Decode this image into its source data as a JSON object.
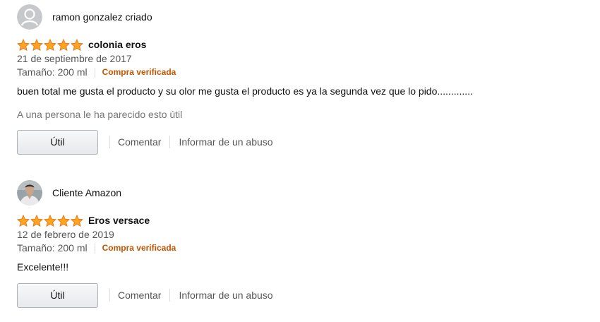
{
  "reviews": [
    {
      "author": "ramon gonzalez criado",
      "avatar": "default-avatar-icon",
      "rating": 5,
      "rating_max": 5,
      "title": "colonia eros",
      "date": "21 de septiembre de 2017",
      "size": "Tamaño: 200 ml",
      "verified": "Compra verificada",
      "body": "buen total me gusta el producto y su olor me gusta el producto es ya la segunda vez que lo pido.............",
      "helpful": "A una persona le ha parecido esto útil",
      "actions": {
        "helpful_button": "Útil",
        "comment": "Comentar",
        "report": "Informar de un abuso"
      }
    },
    {
      "author": "Cliente Amazon",
      "avatar": "user-photo-avatar",
      "rating": 5,
      "rating_max": 5,
      "title": "Eros versace",
      "date": "12 de febrero de 2019",
      "size": "Tamaño: 200 ml",
      "verified": "Compra verificada",
      "body": "Excelente!!!",
      "actions": {
        "helpful_button": "Útil",
        "comment": "Comentar",
        "report": "Informar de un abuso"
      }
    }
  ],
  "colors": {
    "star": "#ffa41c",
    "star_outline": "#de7921",
    "verified": "#c45500",
    "muted_text": "#555555"
  }
}
